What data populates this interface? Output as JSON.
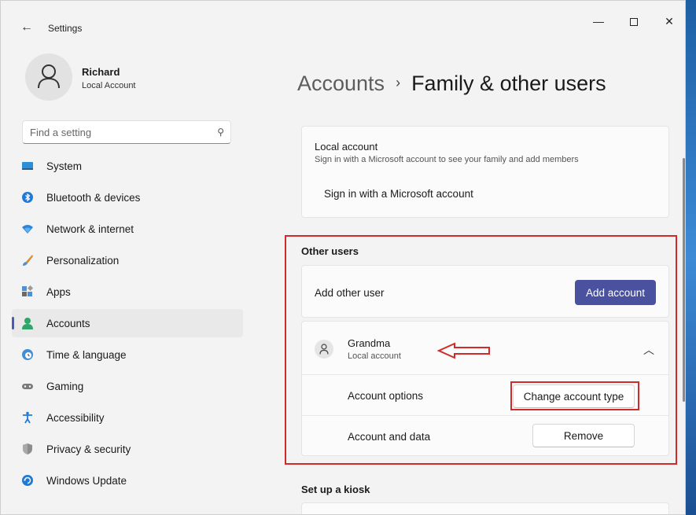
{
  "window": {
    "app_title": "Settings"
  },
  "profile": {
    "name": "Richard",
    "account_type": "Local Account"
  },
  "search": {
    "placeholder": "Find a setting"
  },
  "nav": {
    "items": [
      {
        "label": "System",
        "icon": "monitor-icon"
      },
      {
        "label": "Bluetooth & devices",
        "icon": "bluetooth-icon"
      },
      {
        "label": "Network & internet",
        "icon": "wifi-icon"
      },
      {
        "label": "Personalization",
        "icon": "brush-icon"
      },
      {
        "label": "Apps",
        "icon": "apps-icon"
      },
      {
        "label": "Accounts",
        "icon": "person-icon",
        "active": true
      },
      {
        "label": "Time & language",
        "icon": "globe-clock-icon"
      },
      {
        "label": "Gaming",
        "icon": "gamepad-icon"
      },
      {
        "label": "Accessibility",
        "icon": "accessibility-icon"
      },
      {
        "label": "Privacy & security",
        "icon": "shield-icon"
      },
      {
        "label": "Windows Update",
        "icon": "refresh-icon"
      }
    ]
  },
  "breadcrumb": {
    "parent": "Accounts",
    "current": "Family & other users"
  },
  "local_account": {
    "title": "Local account",
    "description": "Sign in with a Microsoft account to see your family and add members",
    "link": "Sign in with a Microsoft account"
  },
  "other_users": {
    "heading": "Other users",
    "add_label": "Add other user",
    "add_button": "Add account",
    "user": {
      "name": "Grandma",
      "type": "Local account",
      "options_label": "Account options",
      "options_button": "Change account type",
      "data_label": "Account and data",
      "data_button": "Remove"
    }
  },
  "kiosk": {
    "heading": "Set up a kiosk"
  },
  "colors": {
    "accent": "#4a52a0",
    "highlight": "#d22a2a"
  }
}
